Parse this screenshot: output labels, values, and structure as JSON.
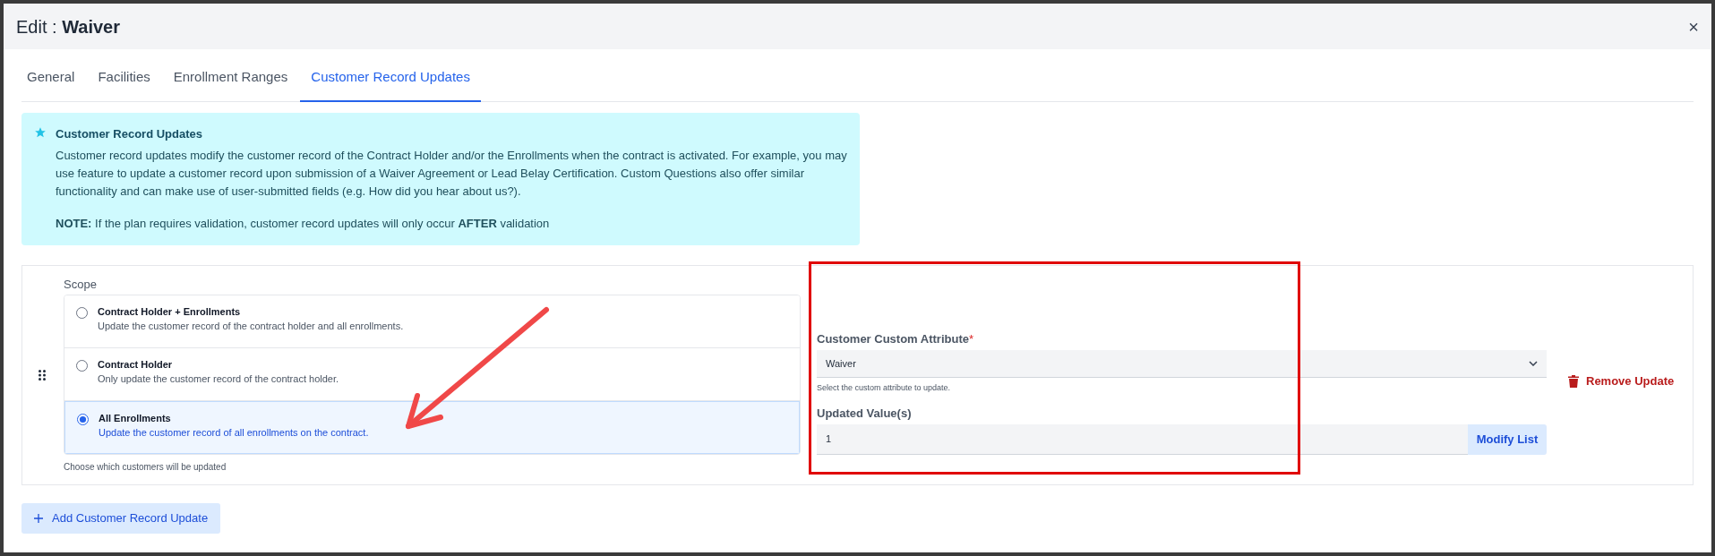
{
  "window": {
    "title": "Edit : **Waiver**",
    "close": "×"
  },
  "tabs": [
    {
      "label": "General",
      "selected": false
    },
    {
      "label": "Facilities",
      "selected": false
    },
    {
      "label": "Enrollment Ranges",
      "selected": false
    },
    {
      "label": "Customer Record Updates",
      "selected": true
    }
  ],
  "info": {
    "title": "Customer Record Updates",
    "body": "Customer record updates modify the customer record of the Contract Holder and/or the Enrollments when the contract is activated. For example, you may use feature to update a customer record upon submission of a Waiver Agreement or Lead Belay Certification. Custom Questions also offer similar functionality and can make use of user-submitted fields (e.g. How did you hear about us?).",
    "note": "**NOTE:** If the plan requires validation, customer record updates will only occur **AFTER** validation"
  },
  "rule": {
    "scope_label": "Scope",
    "options": [
      {
        "title": "Contract Holder + Enrollments",
        "description": "Update the customer record of the contract holder and all enrollments.",
        "selected": false
      },
      {
        "title": "Contract Holder",
        "description": "Only update the customer record of the contract holder.",
        "selected": false
      },
      {
        "title": "All Enrollments",
        "description": "Update the customer record of all enrollments on the contract.",
        "selected": true
      }
    ],
    "scope_hint": "Choose which customers will be updated",
    "attribute": {
      "label": "Customer Custom Attribute",
      "required_mark": "*",
      "value": "Waiver",
      "hint": "Select the custom attribute to update."
    },
    "values": {
      "label": "Updated Value(s)",
      "value": "1",
      "button": "Modify List"
    },
    "remove": "Remove Update"
  },
  "add_button": "Add Customer Record Update"
}
